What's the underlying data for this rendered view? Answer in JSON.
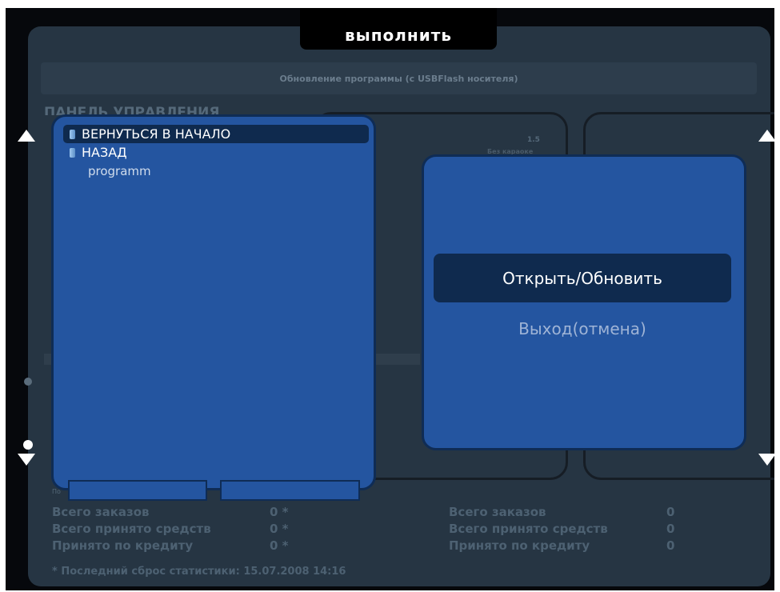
{
  "header": {
    "execute_tab": "выполнить",
    "title": "Обновление программы (с USBFlash носителя)",
    "panel_heading": "ПАНЕЛЬ УПРАВЛЕНИЯ",
    "ghost_number": "1.5",
    "ghost_text": "Без караоке"
  },
  "file_browser": {
    "items": [
      {
        "label": "ВЕРНУТЬСЯ В НАЧАЛО",
        "icon": "folder-icon",
        "selected": true
      },
      {
        "label": "НАЗАД",
        "icon": "folder-icon",
        "selected": false
      },
      {
        "label": "programm",
        "icon": "",
        "selected": false
      }
    ],
    "footer_ghost": "По"
  },
  "actions": {
    "primary": "Открыть/Обновить",
    "secondary": "Выход(отмена)"
  },
  "stats_left": [
    {
      "label": "Всего заказов",
      "value": "0 *"
    },
    {
      "label": "Всего принято средств",
      "value": "0 *"
    },
    {
      "label": "Принято по кредиту",
      "value": "0 *"
    }
  ],
  "stats_right": [
    {
      "label": "Всего заказов",
      "value": "0"
    },
    {
      "label": "Всего принято средств",
      "value": "0"
    },
    {
      "label": "Принято по кредиту",
      "value": "0"
    }
  ],
  "stats_note": "* Последний сброс статистики:  15.07.2008 14:16",
  "colors": {
    "panel_blue": "#2455a0",
    "selected_row": "#0f2a4e",
    "background": "#263543"
  }
}
